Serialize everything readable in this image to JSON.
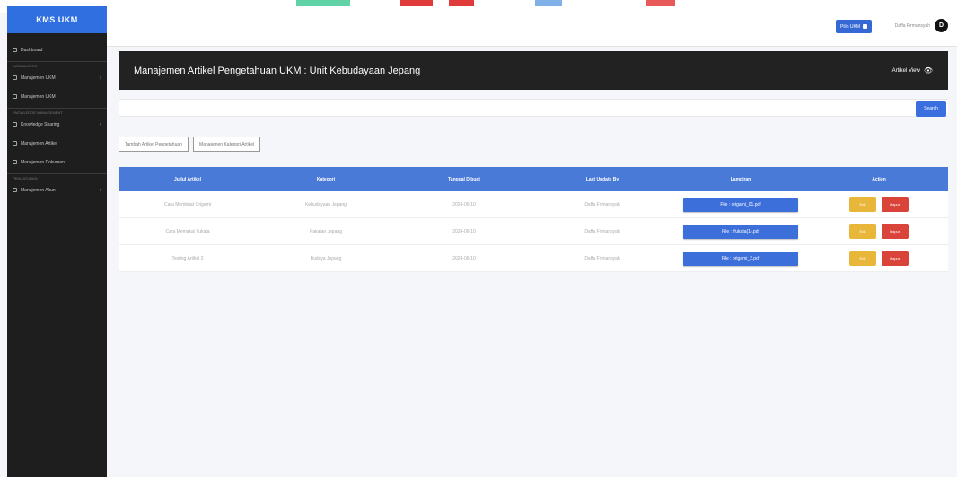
{
  "sidebar": {
    "brand": "KMS UKM",
    "items": [
      {
        "label": "Dashboard",
        "type": "item",
        "chevron": ""
      },
      {
        "label": "DATA MASTER",
        "type": "head"
      },
      {
        "label": "Manajemen UKM",
        "type": "item",
        "chevron": "›"
      },
      {
        "label": "Manajemen UKM",
        "type": "item",
        "chevron": ""
      },
      {
        "label": "KNOWLEDGE MANAGEMENT",
        "type": "head"
      },
      {
        "label": "Knowledge Sharing",
        "type": "item",
        "chevron": "‹"
      },
      {
        "label": "Manajemen Artikel",
        "type": "item",
        "chevron": ""
      },
      {
        "label": "Manajemen Dokumen",
        "type": "item",
        "chevron": ""
      },
      {
        "label": "PENGATURAN",
        "type": "head"
      },
      {
        "label": "Manajemen Akun",
        "type": "item",
        "chevron": "›"
      }
    ]
  },
  "topbar": {
    "ukm_button": "Pilih UKM",
    "user_name": "Daffa Firmansyah",
    "avatar_initial": "D"
  },
  "banner": {
    "title": "Manajemen Artikel Pengetahuan UKM : Unit Kebudayaan Jepang",
    "view_label": "Artikel View"
  },
  "search": {
    "placeholder": "",
    "button": "Search"
  },
  "actions": {
    "add_article": "Tambah Artikel Pengetahuan",
    "manage_category": "Manajemen Kategori Artikel"
  },
  "table": {
    "headers": [
      "Judul Artikel",
      "Kategori",
      "Tanggal Dibuat",
      "Last Update By",
      "Lampiran",
      "Action"
    ],
    "rows": [
      {
        "judul": "Cara Membuat Origami",
        "kategori": "Kebudayaan Jepang",
        "tanggal": "2024-06-10",
        "update_by": "Daffa Firmansyah",
        "lampiran": "File : origami_01.pdf",
        "edit": "Edit",
        "hapus": "Hapus"
      },
      {
        "judul": "Cara Memakai Yukata",
        "kategori": "Pakaian Jepang",
        "tanggal": "2024-06-10",
        "update_by": "Daffa Firmansyah",
        "lampiran": "File : Yukata(1).pdf",
        "edit": "Edit",
        "hapus": "Hapus"
      },
      {
        "judul": "Testing Artikel 2",
        "kategori": "Budaya Jepang",
        "tanggal": "2024-06-10",
        "update_by": "Daffa Firmansyah",
        "lampiran": "File : origami_2.pdf",
        "edit": "Edit",
        "hapus": "Hapus"
      }
    ]
  },
  "colors": {
    "brand": "#2f6fe0",
    "header_blue": "#4a7ad8",
    "edit_yellow": "#e8b73a",
    "delete_red": "#d9433a"
  }
}
